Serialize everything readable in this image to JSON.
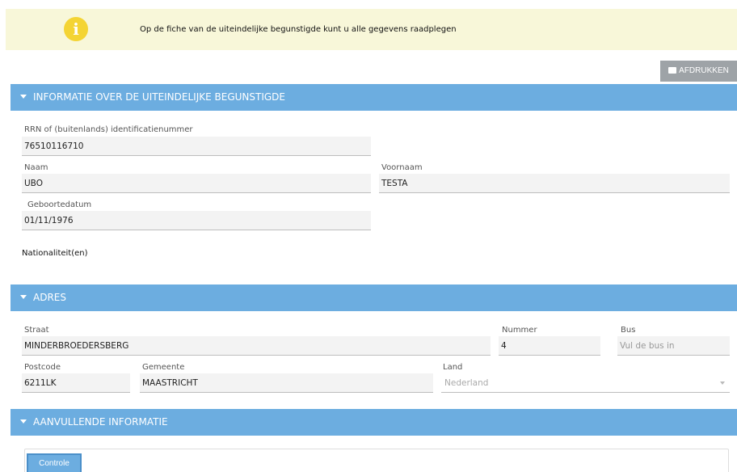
{
  "banner": {
    "icon": "info-icon",
    "icon_glyph": "i",
    "text": "Op de fiche van de uiteindelijke begunstigde kunt u alle gegevens raadplegen"
  },
  "toolbar": {
    "print_label": "AFDRUKKEN",
    "print_icon": "printer-icon"
  },
  "sections": {
    "info": {
      "title": "INFORMATIE OVER DE UITEINDELIJKE BEGUNSTIGDE"
    },
    "address": {
      "title": "ADRES"
    },
    "extra": {
      "title": "AANVULLENDE INFORMATIE"
    }
  },
  "info": {
    "rrn_label": "RRN of (buitenlands) identificatienummer",
    "rrn_value": "76510116710",
    "name_label": "Naam",
    "name_value": "UBO",
    "firstname_label": "Voornaam",
    "firstname_value": "TESTA",
    "birth_label": "Geboortedatum",
    "birth_value": "01/11/1976",
    "nationality_label": "Nationaliteit(en)"
  },
  "address": {
    "street_label": "Straat",
    "street_value": "MINDERBROEDERSBERG",
    "number_label": "Nummer",
    "number_value": "4",
    "bus_label": "Bus",
    "bus_placeholder": "Vul de bus in",
    "postcode_label": "Postcode",
    "postcode_value": "6211LK",
    "city_label": "Gemeente",
    "city_value": "MAASTRICHT",
    "country_label": "Land",
    "country_value": "Nederland"
  },
  "extra": {
    "controle_label": "Controle"
  },
  "colors": {
    "header_blue": "#6cade0",
    "banner_bg": "#f8f7d9",
    "info_yellow": "#f4d434",
    "print_gray": "#9ea3a7"
  }
}
